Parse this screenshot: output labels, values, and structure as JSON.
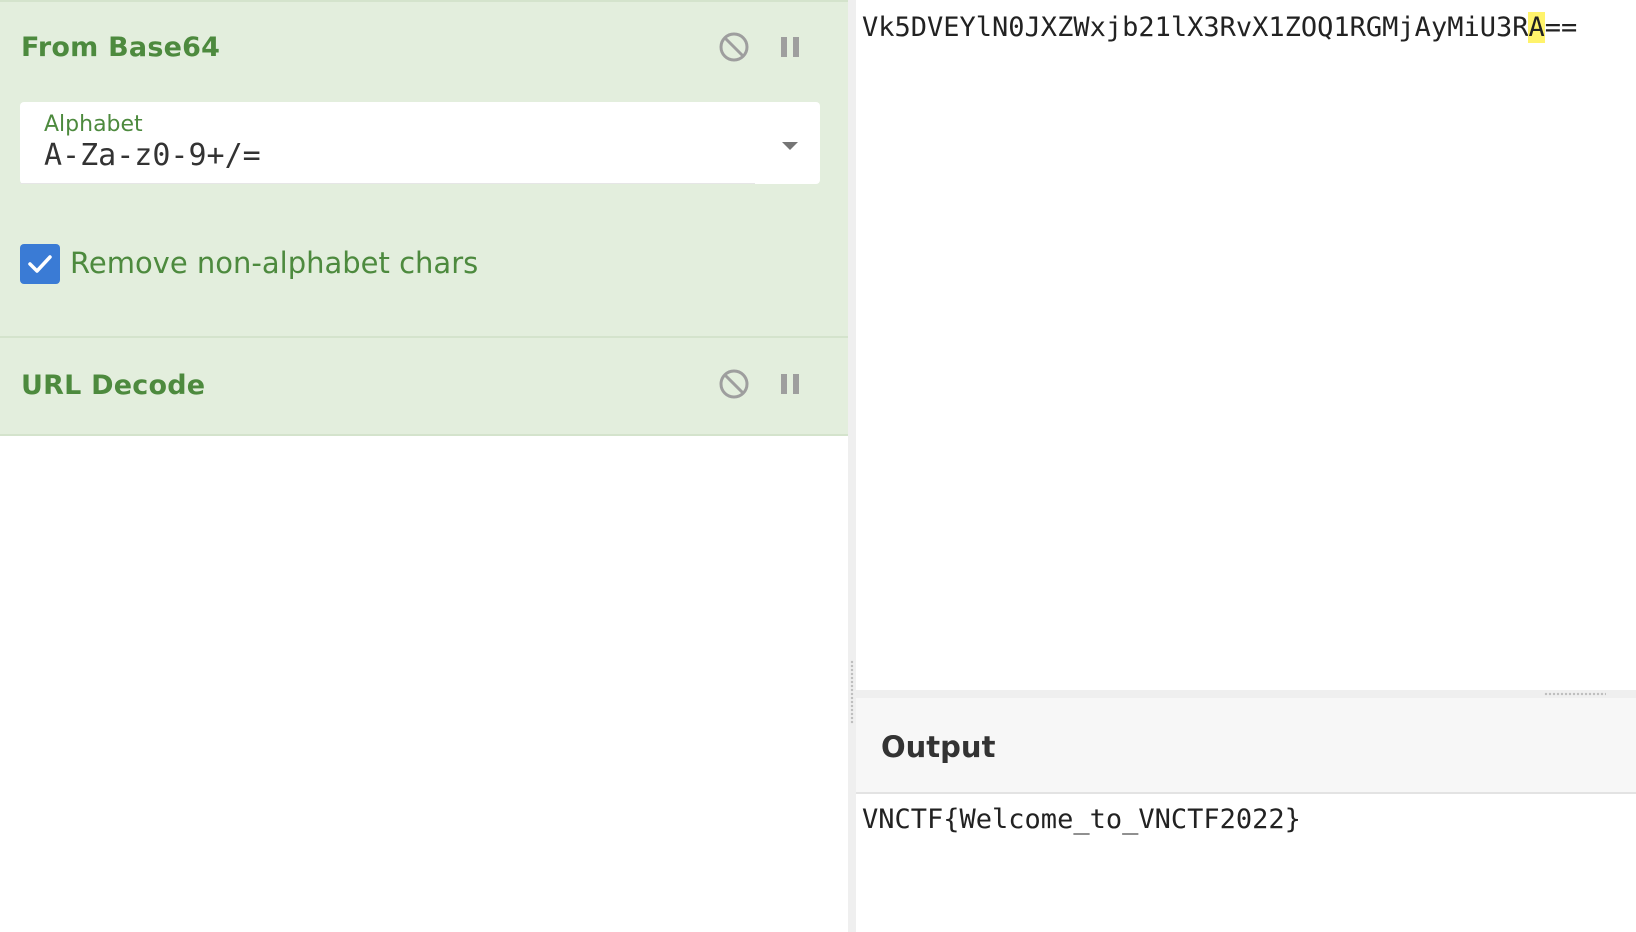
{
  "recipe": {
    "operations": [
      {
        "title": "From Base64",
        "alphabet_label": "Alphabet",
        "alphabet_value": "A-Za-z0-9+/=",
        "checkbox_label": "Remove non-alphabet chars",
        "checkbox_checked": true
      },
      {
        "title": "URL Decode"
      }
    ]
  },
  "input": {
    "text_before_highlight": "Vk5DVEYlN0JXZWxjb21lX3RvX1ZOQ1RGMjAyMiU3R",
    "highlighted_char": "A",
    "text_after_highlight": "=="
  },
  "output": {
    "title": "Output",
    "text": "VNCTF{Welcome_to_VNCTF2022}"
  },
  "icons": {
    "disable": "disable-icon",
    "pause": "pause-icon",
    "dropdown": "chevron-down-icon",
    "check": "check-icon"
  },
  "colors": {
    "operation_bg": "#e3eedd",
    "operation_text": "#4d8a3e",
    "checkbox": "#3a7bd5",
    "highlight": "#fff36b"
  }
}
